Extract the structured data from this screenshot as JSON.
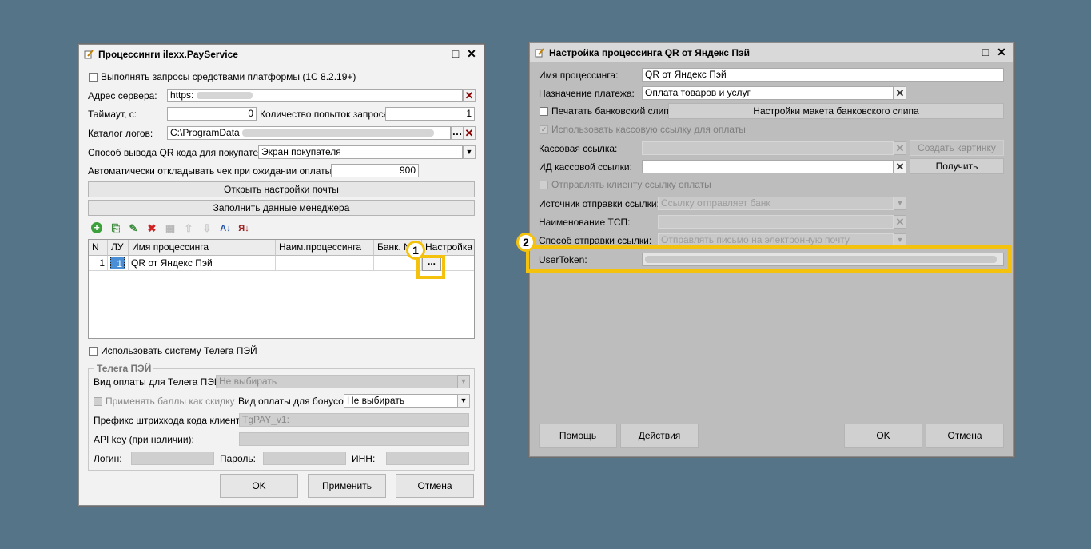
{
  "left_window": {
    "title": "Процессинги ilexx.PayService",
    "title_icon": "edit-doc-icon",
    "checkbox_platform": "Выполнять запросы средствами платформы (1С 8.2.19+)",
    "server_label": "Адрес сервера:",
    "server_value": "https:",
    "timeout_label": "Таймаут, с:",
    "timeout_value": "0",
    "retries_label": "Количество попыток запроса:",
    "retries_value": "1",
    "logs_label": "Каталог логов:",
    "logs_value": "C:\\ProgramData",
    "qr_mode_label": "Способ вывода QR кода для покупателя:",
    "qr_mode_value": "Экран покупателя",
    "postpone_label": "Автоматически откладывать чек при ожидании оплаты, с.:",
    "postpone_value": "900",
    "mail_settings_button": "Открыть настройки почты",
    "manager_data_button": "Заполнить данные менеджера",
    "grid": {
      "headers": [
        "N",
        "ЛУ",
        "Имя процессинга",
        "Наим.процессинга",
        "Банк. N",
        "Настройка"
      ],
      "rows": [
        {
          "n": "1",
          "lu": "1",
          "name": "QR от Яндекс Пэй",
          "short_name": "",
          "bank": "",
          "settings": "..."
        }
      ]
    },
    "telega_checkbox": "Использовать систему Телега ПЭЙ",
    "telega_group_title": "Телега ПЭЙ",
    "telega_pay_type_label": "Вид оплаты для Телега ПЭЙ:",
    "telega_pay_type_value": "Не выбирать",
    "bonus_checkbox": "Применять баллы как скидку",
    "bonus_pay_type_label": "Вид оплаты для бонусов:",
    "bonus_pay_type_value": "Не выбирать",
    "barcode_prefix_label": "Префикс штрихкода кода клиента:",
    "barcode_prefix_value": "TgPAY_v1:",
    "api_key_label": "API key (при наличии):",
    "login_label": "Логин:",
    "password_label": "Пароль:",
    "inn_label": "ИНН:",
    "ok_button": "OK",
    "apply_button": "Применить",
    "cancel_button": "Отмена"
  },
  "right_window": {
    "title": "Настройка процессинга QR от Яндекс Пэй",
    "name_label": "Имя процессинга:",
    "name_value": "QR от Яндекс Пэй",
    "purpose_label": "Назначение платежа:",
    "purpose_value": "Оплата товаров и услуг",
    "print_slip_checkbox": "Печатать банковский слип",
    "slip_layout_button": "Настройки макета банковского слипа",
    "use_link_checkbox": "Использовать кассовую ссылку для оплаты",
    "cash_link_label": "Кассовая ссылка:",
    "create_qr_button": "Создать картинку QR",
    "cash_link_id_label": "ИД кассовой ссылки:",
    "get_button": "Получить",
    "send_link_checkbox": "Отправлять клиенту ссылку оплаты",
    "link_source_label": "Источник отправки ссылки:",
    "link_source_value": "Ссылку отправляет банк",
    "tsp_name_label": "Наименование ТСП:",
    "send_method_label": "Способ отправки ссылки:",
    "send_method_value": "Отправлять письмо на электронную почту",
    "user_token_label": "UserToken:",
    "help_button": "Помощь",
    "actions_button": "Действия",
    "ok_button": "OK",
    "cancel_button": "Отмена"
  },
  "callouts": {
    "first": "1",
    "second": "2"
  },
  "colors": {
    "background": "#557487",
    "highlight": "#f4c20d"
  }
}
